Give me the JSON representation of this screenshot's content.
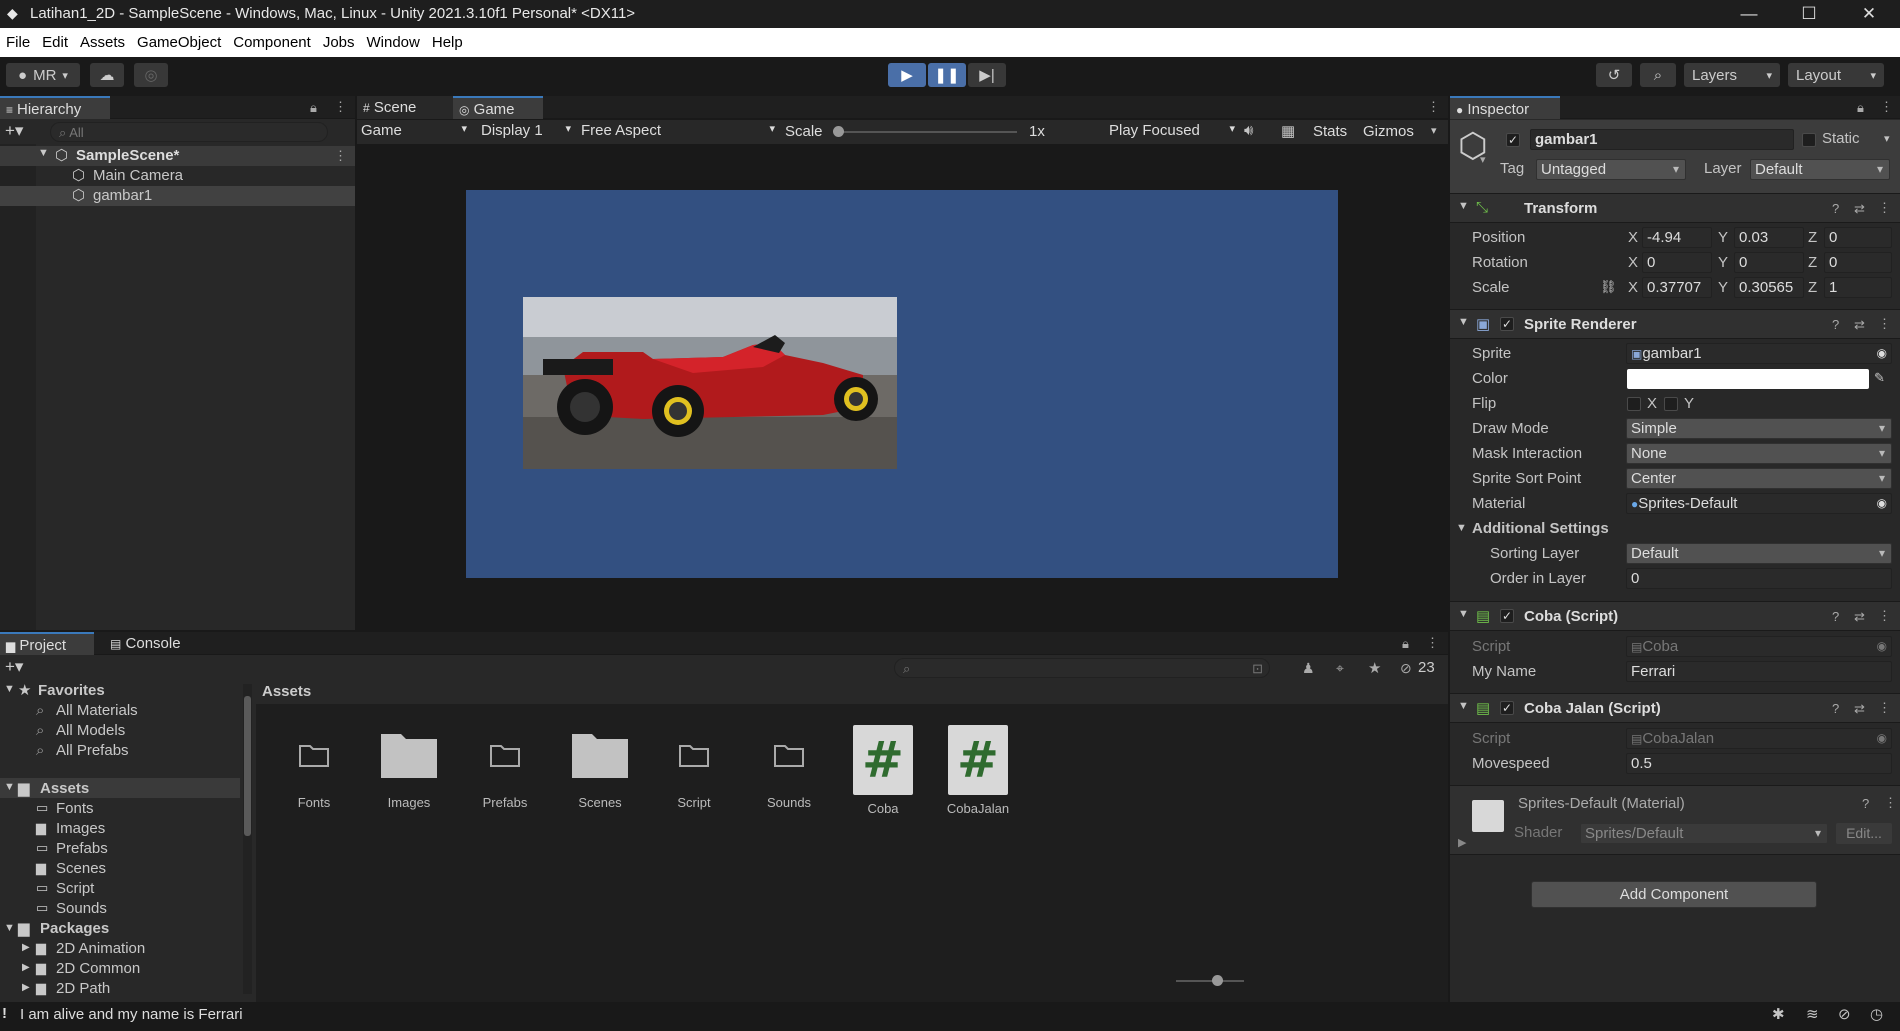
{
  "window": {
    "title": "Latihan1_2D - SampleScene - Windows, Mac, Linux - Unity 2021.3.10f1 Personal* <DX11>"
  },
  "menu": [
    "File",
    "Edit",
    "Assets",
    "GameObject",
    "Component",
    "Jobs",
    "Window",
    "Help"
  ],
  "toolbar": {
    "account": "MR",
    "layers": "Layers",
    "layout": "Layout"
  },
  "hierarchy": {
    "title": "Hierarchy",
    "search_placeholder": "All",
    "scene": "SampleScene*",
    "items": [
      "Main Camera",
      "gambar1"
    ]
  },
  "game": {
    "tabs": [
      "Scene",
      "Game"
    ],
    "display_mode": "Game",
    "display": "Display 1",
    "aspect": "Free Aspect",
    "scale_label": "Scale",
    "scale_value": "1x",
    "play_mode": "Play Focused",
    "stats": "Stats",
    "gizmos": "Gizmos",
    "camera_bg": "#335081"
  },
  "inspector": {
    "title": "Inspector",
    "object_name": "gambar1",
    "static_label": "Static",
    "tag_label": "Tag",
    "tag": "Untagged",
    "layer_label": "Layer",
    "layer": "Default",
    "transform": {
      "title": "Transform",
      "position_label": "Position",
      "rotation_label": "Rotation",
      "scale_label": "Scale",
      "position": {
        "x": "-4.94",
        "y": "0.03",
        "z": "0"
      },
      "rotation": {
        "x": "0",
        "y": "0",
        "z": "0"
      },
      "scale": {
        "x": "0.37707",
        "y": "0.30565",
        "z": "1"
      }
    },
    "sprite_renderer": {
      "title": "Sprite Renderer",
      "sprite_label": "Sprite",
      "sprite": "gambar1",
      "color_label": "Color",
      "color": "#ffffff",
      "flip_label": "Flip",
      "flip_x": "X",
      "flip_y": "Y",
      "draw_mode_label": "Draw Mode",
      "draw_mode": "Simple",
      "mask_label": "Mask Interaction",
      "mask": "None",
      "sort_point_label": "Sprite Sort Point",
      "sort_point": "Center",
      "material_label": "Material",
      "material": "Sprites-Default",
      "additional_label": "Additional Settings",
      "sorting_layer_label": "Sorting Layer",
      "sorting_layer": "Default",
      "order_label": "Order in Layer",
      "order": "0"
    },
    "coba": {
      "title": "Coba (Script)",
      "script_label": "Script",
      "script": "Coba",
      "name_label": "My Name",
      "name": "Ferrari"
    },
    "coba_jalan": {
      "title": "Coba Jalan (Script)",
      "script_label": "Script",
      "script": "CobaJalan",
      "speed_label": "Movespeed",
      "speed": "0.5"
    },
    "material": {
      "title": "Sprites-Default (Material)",
      "shader_label": "Shader",
      "shader": "Sprites/Default",
      "edit": "Edit..."
    },
    "add_component": "Add Component"
  },
  "project": {
    "tabs": [
      "Project",
      "Console"
    ],
    "hidden_count": "23",
    "favorites_title": "Favorites",
    "favorites": [
      "All Materials",
      "All Models",
      "All Prefabs"
    ],
    "assets_title": "Assets",
    "asset_folders": [
      "Fonts",
      "Images",
      "Prefabs",
      "Scenes",
      "Script",
      "Sounds"
    ],
    "packages_title": "Packages",
    "packages": [
      "2D Animation",
      "2D Common",
      "2D Path"
    ],
    "breadcrumb": "Assets",
    "grid": [
      {
        "name": "Fonts",
        "icon": "folder-empty-icon"
      },
      {
        "name": "Images",
        "icon": "folder-full-icon"
      },
      {
        "name": "Prefabs",
        "icon": "folder-empty-icon"
      },
      {
        "name": "Scenes",
        "icon": "folder-full-icon"
      },
      {
        "name": "Script",
        "icon": "folder-empty-icon"
      },
      {
        "name": "Sounds",
        "icon": "folder-empty-icon"
      },
      {
        "name": "Coba",
        "icon": "csharp-script-icon"
      },
      {
        "name": "CobaJalan",
        "icon": "csharp-script-icon"
      }
    ]
  },
  "status": {
    "message": "I am alive and my name is Ferrari"
  }
}
